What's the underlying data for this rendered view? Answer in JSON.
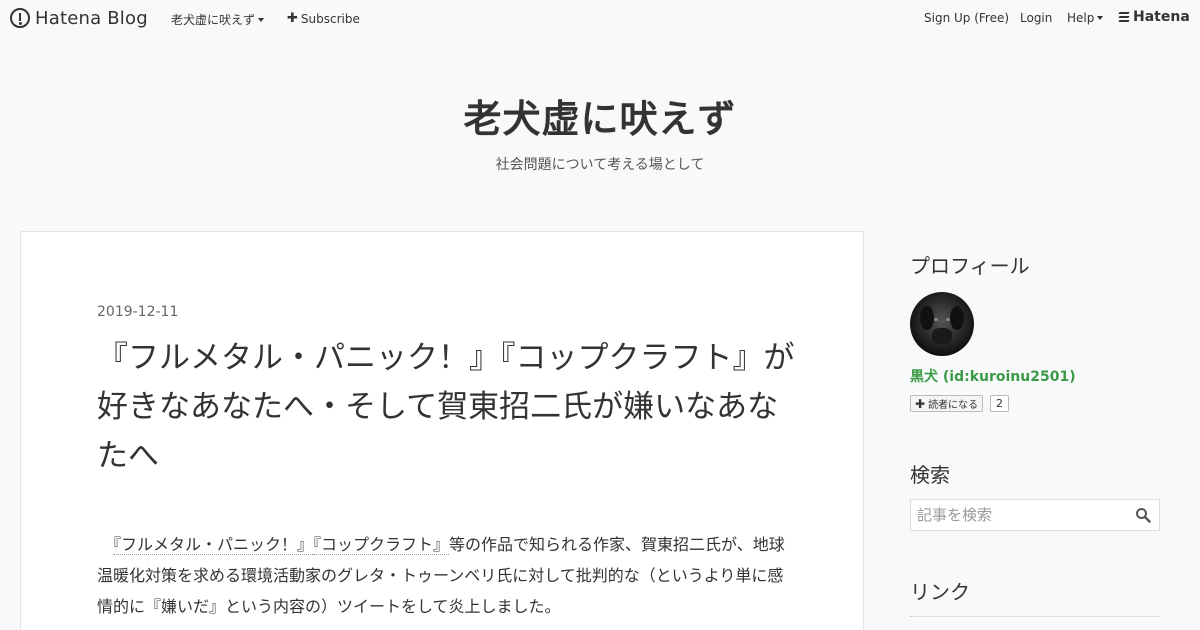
{
  "globalbar": {
    "logo_text": "Hatena Blog",
    "blog_menu_label": "老犬虚に吠えず",
    "subscribe_label": "Subscribe",
    "signup_label": "Sign Up (Free)",
    "login_label": "Login",
    "help_label": "Help",
    "hatena_label": "Hatena"
  },
  "header": {
    "title": "老犬虚に吠えず",
    "description": "社会問題について考える場として"
  },
  "article": {
    "date": "2019-12-11",
    "title": "『フルメタル・パニック！』『コップクラフト』が好きなあなたへ・そして賀東招二氏が嫌いなあなたへ",
    "body": {
      "lead_indent": "　",
      "kw1": "『フルメタル・パニック！』",
      "kw2": "『コップクラフト』",
      "text1": "等の作品で知られる作家、賀東招二氏が、地球温暖化対策を求める環境活動家のグレタ・トゥーンベリ氏に対して批判的な（というより単に感情的に『嫌いだ』という内容の）ツイートをして炎上しました。"
    }
  },
  "sidebar": {
    "profile_title": "プロフィール",
    "profile_name": "黒犬 (id:kuroinu2501)",
    "reader_button": "読者になる",
    "reader_count": "2",
    "search_title": "検索",
    "search_placeholder": "記事を検索",
    "link_title": "リンク"
  },
  "icons": {
    "logo": "hatena-blog-logo-icon",
    "subscribe": "plus-icon",
    "search": "search-icon",
    "avatar": "black-dog-avatar"
  },
  "colors": {
    "background": "#f8f9fa",
    "profile_link": "#3c9a47"
  }
}
